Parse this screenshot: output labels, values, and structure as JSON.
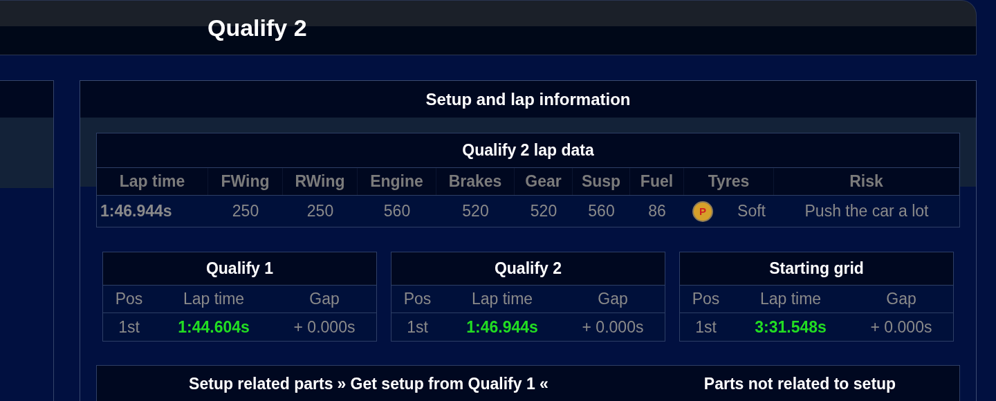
{
  "header": {
    "title": "Qualify 2"
  },
  "panel": {
    "title": "Setup and lap information"
  },
  "lap_data": {
    "title": "Qualify 2 lap data",
    "columns": [
      "Lap time",
      "FWing",
      "RWing",
      "Engine",
      "Brakes",
      "Gear",
      "Susp",
      "Fuel",
      "Tyres",
      "Risk"
    ],
    "cells": [
      {
        "kind": "time",
        "text": "1:46.944s"
      },
      {
        "kind": "value",
        "text": "250"
      },
      {
        "kind": "value",
        "text": "250"
      },
      {
        "kind": "value",
        "text": "560"
      },
      {
        "kind": "value",
        "text": "520"
      },
      {
        "kind": "value",
        "text": "520"
      },
      {
        "kind": "value",
        "text": "560"
      },
      {
        "kind": "value",
        "text": "86"
      },
      {
        "kind": "tyre",
        "icon": "P",
        "text": "Soft"
      },
      {
        "kind": "value",
        "text": "Push the car a lot"
      }
    ]
  },
  "sessions": [
    {
      "title": "Qualify 1",
      "columns": [
        "Pos",
        "Lap time",
        "Gap"
      ],
      "pos": "1st",
      "lap_time": "1:44.604s",
      "gap": "+ 0.000s"
    },
    {
      "title": "Qualify 2",
      "columns": [
        "Pos",
        "Lap time",
        "Gap"
      ],
      "pos": "1st",
      "lap_time": "1:46.944s",
      "gap": "+ 0.000s"
    },
    {
      "title": "Starting grid",
      "columns": [
        "Pos",
        "Lap time",
        "Gap"
      ],
      "pos": "1st",
      "lap_time": "3:31.548s",
      "gap": "+ 0.000s"
    }
  ],
  "setup_bar": {
    "title": "Setup related parts",
    "link": "» Get setup from Qualify 1 «",
    "other": "Parts not related to setup"
  }
}
